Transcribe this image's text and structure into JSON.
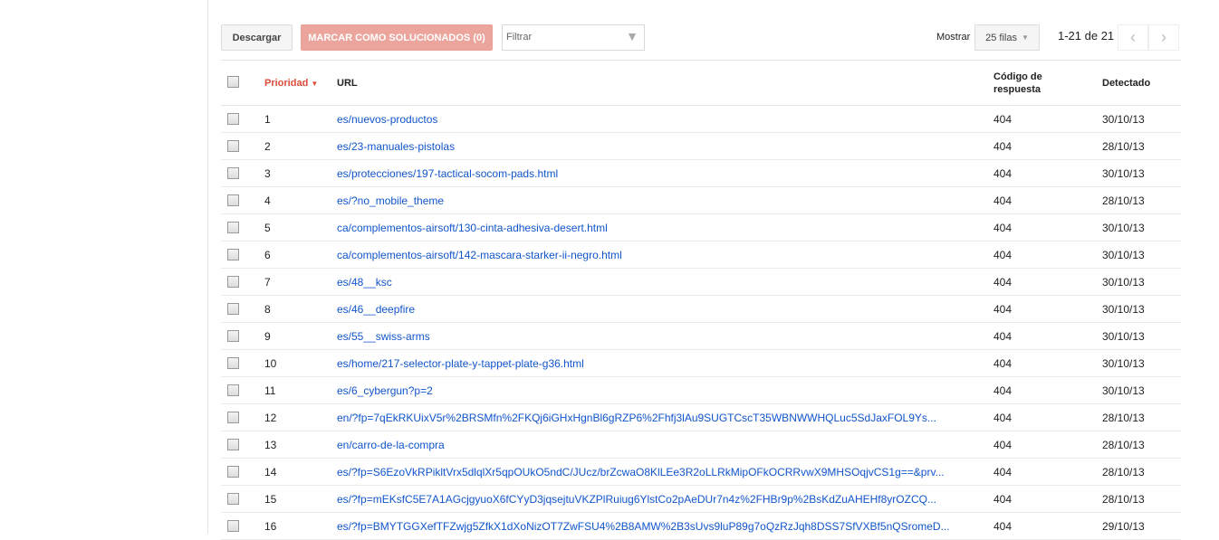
{
  "toolbar": {
    "download": "Descargar",
    "mark_fixed": "MARCAR COMO SOLUCIONADOS (0)",
    "filter_placeholder": "Filtrar",
    "show_label": "Mostrar",
    "rows_select": "25 filas",
    "pagination": "1-21 de 21"
  },
  "colors": {
    "accent": "#dd4b39",
    "link": "#1155cc",
    "mark_button": "#eba59c"
  },
  "table": {
    "headers": {
      "priority": "Prioridad",
      "url": "URL",
      "code_line1": "Código de",
      "code_line2": "respuesta",
      "detected": "Detectado"
    },
    "rows": [
      {
        "p": "1",
        "url": "es/nuevos-productos",
        "code": "404",
        "det": "30/10/13"
      },
      {
        "p": "2",
        "url": "es/23-manuales-pistolas",
        "code": "404",
        "det": "28/10/13"
      },
      {
        "p": "3",
        "url": "es/protecciones/197-tactical-socom-pads.html",
        "code": "404",
        "det": "30/10/13"
      },
      {
        "p": "4",
        "url": "es/?no_mobile_theme",
        "code": "404",
        "det": "28/10/13"
      },
      {
        "p": "5",
        "url": "ca/complementos-airsoft/130-cinta-adhesiva-desert.html",
        "code": "404",
        "det": "30/10/13"
      },
      {
        "p": "6",
        "url": "ca/complementos-airsoft/142-mascara-starker-ii-negro.html",
        "code": "404",
        "det": "30/10/13"
      },
      {
        "p": "7",
        "url": "es/48__ksc",
        "code": "404",
        "det": "30/10/13"
      },
      {
        "p": "8",
        "url": "es/46__deepfire",
        "code": "404",
        "det": "30/10/13"
      },
      {
        "p": "9",
        "url": "es/55__swiss-arms",
        "code": "404",
        "det": "30/10/13"
      },
      {
        "p": "10",
        "url": "es/home/217-selector-plate-y-tappet-plate-g36.html",
        "code": "404",
        "det": "30/10/13"
      },
      {
        "p": "11",
        "url": "es/6_cybergun?p=2",
        "code": "404",
        "det": "30/10/13"
      },
      {
        "p": "12",
        "url": "en/?fp=7qEkRKUixV5r%2BRSMfn%2FKQj6iGHxHgnBl6gRZP6%2Fhfj3lAu9SUGTCscT35WBNWWHQLuc5SdJaxFOL9Ys...",
        "code": "404",
        "det": "28/10/13"
      },
      {
        "p": "13",
        "url": "en/carro-de-la-compra",
        "code": "404",
        "det": "28/10/13"
      },
      {
        "p": "14",
        "url": "es/?fp=S6EzoVkRPikltVrx5dlqlXr5qpOUkO5ndC/JUcz/brZcwaO8KlLEe3R2oLLRkMipOFkOCRRvwX9MHSOqjvCS1g==&prv...",
        "code": "404",
        "det": "28/10/13"
      },
      {
        "p": "15",
        "url": "es/?fp=mEKsfC5E7A1AGcjgyuoX6fCYyD3jqsejtuVKZPlRuiug6YlstCo2pAeDUr7n4z%2FHBr9p%2BsKdZuAHEHf8yrOZCQ...",
        "code": "404",
        "det": "28/10/13"
      },
      {
        "p": "16",
        "url": "es/?fp=BMYTGGXefTFZwjg5ZfkX1dXoNizOT7ZwFSU4%2B8AMW%2B3sUvs9luP89g7oQzRzJqh8DSS7SfVXBf5nQSromeD...",
        "code": "404",
        "det": "29/10/13"
      }
    ]
  }
}
